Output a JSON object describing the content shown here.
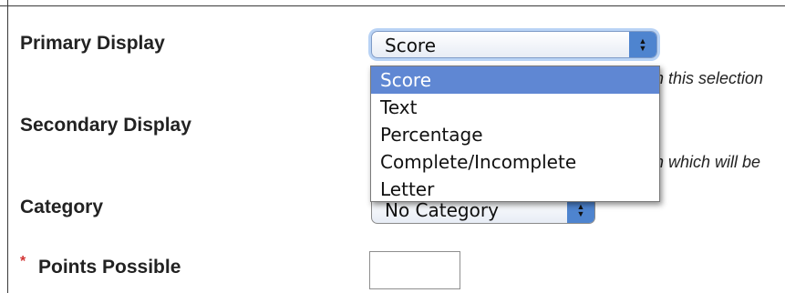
{
  "fields": {
    "primary_display": {
      "label": "Primary Display",
      "value": "Score"
    },
    "secondary_display": {
      "label": "Secondary Display",
      "hint": "n which will be"
    },
    "category": {
      "label": "Category",
      "value": "No Category"
    },
    "points_possible": {
      "required_marker": "*",
      "label": "Points Possible",
      "value": ""
    }
  },
  "primary_hint": "n this selection",
  "dropdown": {
    "options": [
      "Score",
      "Text",
      "Percentage",
      "Complete/Incomplete",
      "Letter"
    ],
    "selected": "Score"
  },
  "colors": {
    "highlight": "#5f87d3",
    "stepper": "#4e84cf",
    "required": "#d23333"
  },
  "icons": {
    "select_stepper": "up-down-arrows-icon"
  }
}
